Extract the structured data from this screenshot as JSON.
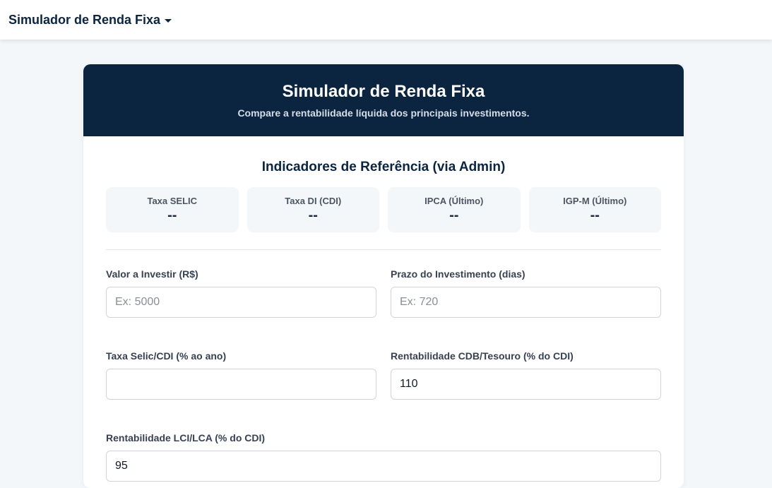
{
  "navbar": {
    "brand_label": "Simulador de Renda Fixa"
  },
  "card": {
    "title": "Simulador de Renda Fixa",
    "subtitle": "Compare a rentabilidade líquida dos principais investimentos."
  },
  "indicators": {
    "section_title": "Indicadores de Referência (via Admin)",
    "items": [
      {
        "label": "Taxa SELIC",
        "value": "--"
      },
      {
        "label": "Taxa DI (CDI)",
        "value": "--"
      },
      {
        "label": "IPCA (Último)",
        "value": "--"
      },
      {
        "label": "IGP-M (Último)",
        "value": "--"
      }
    ]
  },
  "form": {
    "valor": {
      "label": "Valor a Investir (R$)",
      "placeholder": "Ex: 5000",
      "value": ""
    },
    "prazo": {
      "label": "Prazo do Investimento (dias)",
      "placeholder": "Ex: 720",
      "value": ""
    },
    "selic": {
      "label": "Taxa Selic/CDI (% ao ano)",
      "placeholder": "",
      "value": ""
    },
    "cdb": {
      "label": "Rentabilidade CDB/Tesouro (% do CDI)",
      "placeholder": "",
      "value": "110"
    },
    "lci": {
      "label": "Rentabilidade LCI/LCA (% do CDI)",
      "placeholder": "",
      "value": "95"
    }
  },
  "colors": {
    "header_bg": "#0b2540",
    "page_bg": "#f4f7fa",
    "indicator_bg": "#f4f7fa"
  },
  "icons": {
    "brand_dropdown": "caret-down-icon"
  }
}
